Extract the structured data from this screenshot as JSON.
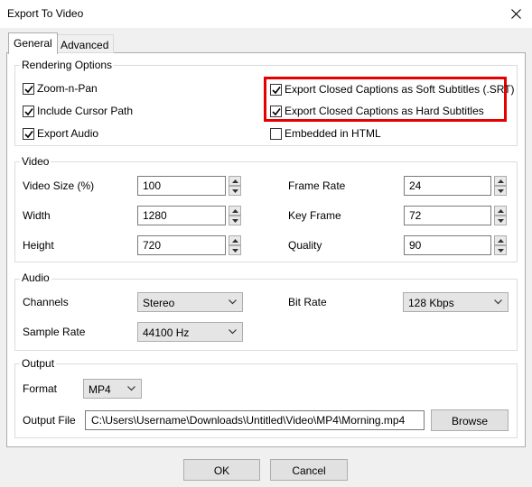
{
  "window": {
    "title": "Export To Video"
  },
  "tabs": [
    {
      "label": "General",
      "active": true
    },
    {
      "label": "Advanced",
      "active": false
    }
  ],
  "rendering": {
    "group_label": "Rendering Options",
    "zoom_n_pan": {
      "label": "Zoom-n-Pan",
      "checked": true
    },
    "include_cursor_path": {
      "label": "Include Cursor Path",
      "checked": true
    },
    "export_audio": {
      "label": "Export Audio",
      "checked": true
    },
    "soft_subtitles": {
      "label": "Export Closed Captions as Soft Subtitles (.SRT)",
      "checked": true
    },
    "hard_subtitles": {
      "label": "Export Closed Captions as Hard Subtitles",
      "checked": true
    },
    "embedded_html": {
      "label": "Embedded in HTML",
      "checked": false
    },
    "highlight_color": "#e60000"
  },
  "video": {
    "group_label": "Video",
    "video_size": {
      "label": "Video Size (%)",
      "value": "100"
    },
    "width": {
      "label": "Width",
      "value": "1280"
    },
    "height": {
      "label": "Height",
      "value": "720"
    },
    "frame_rate": {
      "label": "Frame Rate",
      "value": "24"
    },
    "key_frame": {
      "label": "Key Frame",
      "value": "72"
    },
    "quality": {
      "label": "Quality",
      "value": "90"
    }
  },
  "audio": {
    "group_label": "Audio",
    "channels": {
      "label": "Channels",
      "value": "Stereo"
    },
    "sample_rate": {
      "label": "Sample Rate",
      "value": "44100 Hz"
    },
    "bit_rate": {
      "label": "Bit Rate",
      "value": "128 Kbps"
    }
  },
  "output": {
    "group_label": "Output",
    "format": {
      "label": "Format",
      "value": "MP4"
    },
    "output_file": {
      "label": "Output File",
      "value": "C:\\Users\\Username\\Downloads\\Untitled\\Video\\MP4\\Morning.mp4"
    },
    "browse_label": "Browse"
  },
  "footer": {
    "ok_label": "OK",
    "cancel_label": "Cancel"
  }
}
